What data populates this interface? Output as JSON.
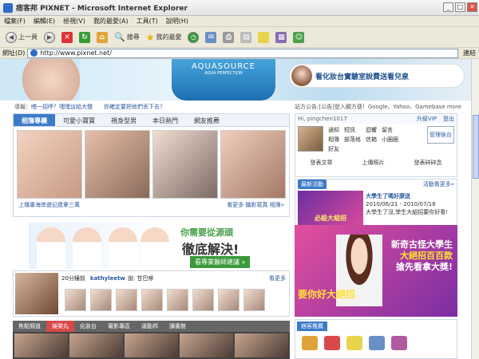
{
  "window": {
    "title": "痞客邦 PIXNET - Microsoft Internet Explorer",
    "min": "_",
    "max": "□",
    "close": "✕"
  },
  "menu": [
    "檔案(F)",
    "編輯(E)",
    "檢視(V)",
    "我的最愛(A)",
    "工具(T)",
    "說明(H)"
  ],
  "toolbar": {
    "back": "上一頁",
    "search": "搜尋",
    "favorites": "我的最愛"
  },
  "address": {
    "label": "網址(D)",
    "value": "http://www.pixnet.net/",
    "go": "連結"
  },
  "hero": {
    "brand": "AQUASOURCE",
    "brand_sub": "AQUA PERFECTION",
    "promo": "看化妝台實驗室說費送看兒泉"
  },
  "notice": {
    "label": "導報：",
    "link1": "喂一招呼？嘿嘿這給大聲",
    "link2": "你確定要把他們丟下去？",
    "right": "站方公告:[公告]登入顯方便！Google、Yahoo、Gamebase more"
  },
  "photos": {
    "tabs": [
      "相簿專欄",
      "可愛小寶寶",
      "視身型男",
      "本日熱門",
      "網友推薦"
    ],
    "caption": "上傳專海岸遊記歲拿三萬",
    "more": "看更多 攝影寫真 相簿»"
  },
  "user": {
    "greeting": "Hi, pingchen1017",
    "upgrade": "升級VIP",
    "logout": "登出",
    "links": [
      "通知",
      "短訊",
      "迴響",
      "留言",
      "相簿",
      "部落格",
      "信箱",
      "小圈圈",
      "好友"
    ],
    "manage": "管理後台",
    "actions": [
      "發表文章",
      "上傳照片",
      "發表碎碎念"
    ]
  },
  "news": {
    "tag": "最新活動",
    "more": "活動看更多»",
    "title": "大學生了嗎好康送",
    "text": "2010/06/21 - 2010/07/18\n大學生了沒,學生大組招要你好看!",
    "img_label": "必殺大組招"
  },
  "clinic": {
    "line1": "你需要從源頭",
    "line2": "徹底解決!",
    "button": "看專業醫師建議 »"
  },
  "talk": {
    "prefix": "20分鐘前",
    "user": "kathyleetw",
    "said": "說: 甘巴嗲",
    "more": "看更多"
  },
  "channels": {
    "tabs": [
      "焦點頻道",
      "娛樂丸",
      "化妝台",
      "電影專區",
      "運動邦",
      "讀書館"
    ]
  },
  "ad": {
    "line1": "新奇古怪大學生",
    "line2": "大絕招百百款",
    "line3": "搶先看拿大獎!",
    "bottom": "要你好大絕招"
  },
  "recom": {
    "tag": "痞客推薦"
  }
}
